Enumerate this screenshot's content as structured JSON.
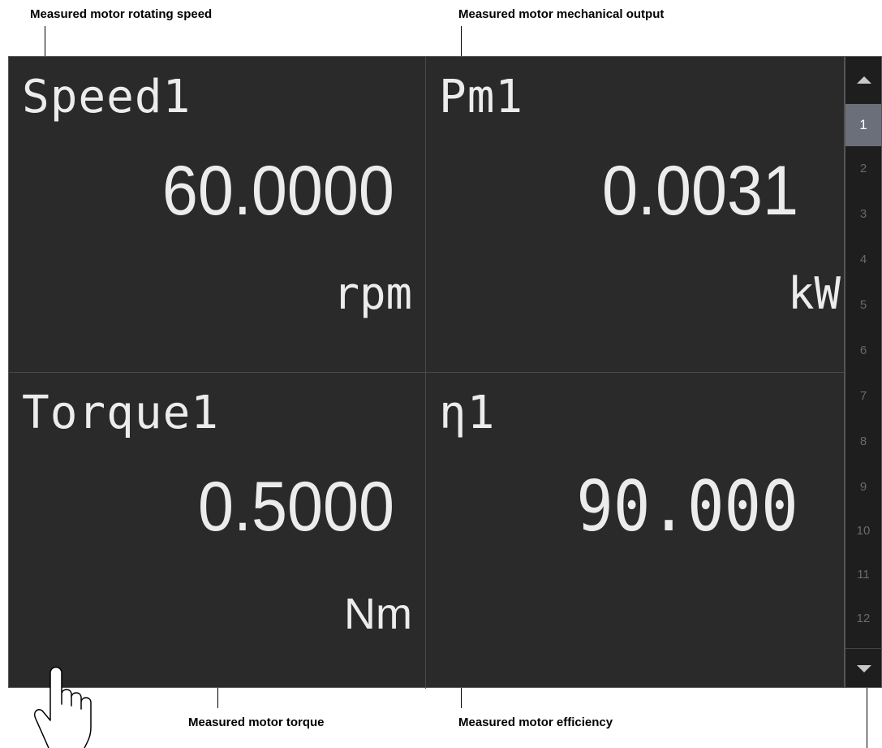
{
  "callouts": {
    "speed": "Measured motor rotating speed",
    "output": "Measured motor mechanical output",
    "torque": "Measured motor torque",
    "efficiency": "Measured motor efficiency"
  },
  "cells": [
    {
      "name": "Speed1",
      "value": "60.0000",
      "unit": "rpm"
    },
    {
      "name": "Pm1",
      "value": "0.0031",
      "unit": "kW"
    },
    {
      "name": "Torque1",
      "value": "0.5000",
      "unit": "Nm"
    },
    {
      "name": "η1",
      "value": "90.000",
      "unit": ""
    }
  ],
  "pager": {
    "pages": [
      "1",
      "2",
      "3",
      "4",
      "5",
      "6",
      "7",
      "8",
      "9",
      "10",
      "11",
      "12"
    ],
    "active": "1",
    "up_icon": "triangle-up-icon",
    "down_icon": "triangle-down-icon"
  },
  "colors": {
    "screen_bg": "#2a2a2a",
    "text": "#ececec",
    "active_page_bg": "#6b6f7a"
  },
  "icons": {
    "hand": "pointing-hand-icon"
  }
}
